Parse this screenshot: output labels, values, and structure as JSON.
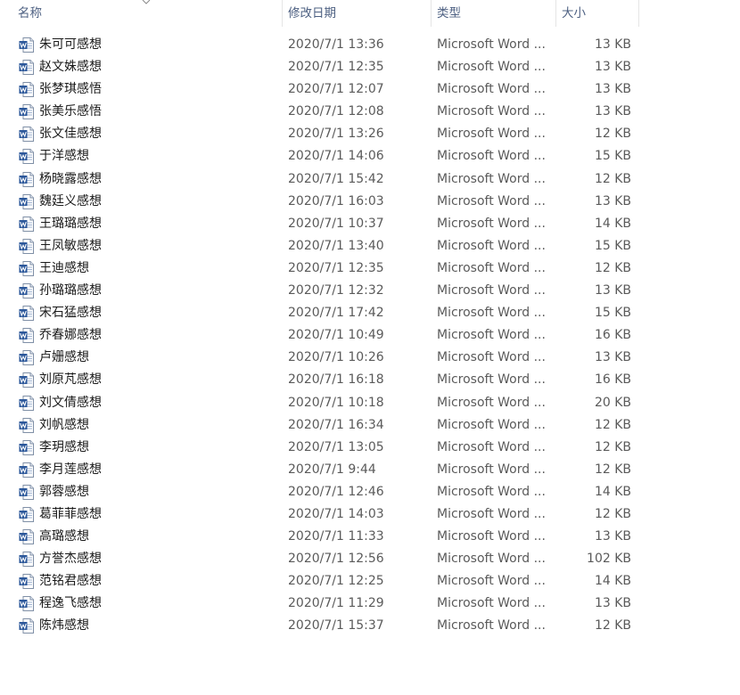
{
  "columns": {
    "name": "名称",
    "date": "修改日期",
    "type": "类型",
    "size": "大小"
  },
  "icons": {
    "file": "word-document-icon",
    "sort": "chevron-down-icon"
  },
  "colors": {
    "header_text": "#4d6082",
    "word_blue": "#2b579a"
  },
  "files": [
    {
      "name": "朱可可感想",
      "date": "2020/7/1 13:36",
      "type": "Microsoft Word ...",
      "size": "13 KB"
    },
    {
      "name": "赵文姝感想",
      "date": "2020/7/1 12:35",
      "type": "Microsoft Word ...",
      "size": "13 KB"
    },
    {
      "name": "张梦琪感悟",
      "date": "2020/7/1 12:07",
      "type": "Microsoft Word ...",
      "size": "13 KB"
    },
    {
      "name": "张美乐感悟",
      "date": "2020/7/1 12:08",
      "type": "Microsoft Word ...",
      "size": "13 KB"
    },
    {
      "name": "张文佳感想",
      "date": "2020/7/1 13:26",
      "type": "Microsoft Word ...",
      "size": "12 KB"
    },
    {
      "name": "于洋感想",
      "date": "2020/7/1 14:06",
      "type": "Microsoft Word ...",
      "size": "15 KB"
    },
    {
      "name": "杨晓露感想",
      "date": "2020/7/1 15:42",
      "type": "Microsoft Word ...",
      "size": "12 KB"
    },
    {
      "name": "魏廷义感想",
      "date": "2020/7/1 16:03",
      "type": "Microsoft Word ...",
      "size": "13 KB"
    },
    {
      "name": "王璐璐感想",
      "date": "2020/7/1 10:37",
      "type": "Microsoft Word ...",
      "size": "14 KB"
    },
    {
      "name": "王凤敏感想",
      "date": "2020/7/1 13:40",
      "type": "Microsoft Word ...",
      "size": "15 KB"
    },
    {
      "name": "王迪感想",
      "date": "2020/7/1 12:35",
      "type": "Microsoft Word ...",
      "size": "12 KB"
    },
    {
      "name": "孙璐璐感想",
      "date": "2020/7/1 12:32",
      "type": "Microsoft Word ...",
      "size": "13 KB"
    },
    {
      "name": "宋石猛感想",
      "date": "2020/7/1 17:42",
      "type": "Microsoft Word ...",
      "size": "15 KB"
    },
    {
      "name": "乔春娜感想",
      "date": "2020/7/1 10:49",
      "type": "Microsoft Word ...",
      "size": "16 KB"
    },
    {
      "name": "卢姗感想",
      "date": "2020/7/1 10:26",
      "type": "Microsoft Word ...",
      "size": "13 KB"
    },
    {
      "name": "刘原芃感想",
      "date": "2020/7/1 16:18",
      "type": "Microsoft Word ...",
      "size": "16 KB"
    },
    {
      "name": "刘文倩感想",
      "date": "2020/7/1 10:18",
      "type": "Microsoft Word ...",
      "size": "20 KB"
    },
    {
      "name": "刘帆感想",
      "date": "2020/7/1 16:34",
      "type": "Microsoft Word ...",
      "size": "12 KB"
    },
    {
      "name": "李玥感想",
      "date": "2020/7/1 13:05",
      "type": "Microsoft Word ...",
      "size": "12 KB"
    },
    {
      "name": "李月莲感想",
      "date": "2020/7/1 9:44",
      "type": "Microsoft Word ...",
      "size": "12 KB"
    },
    {
      "name": "郭蓉感想",
      "date": "2020/7/1 12:46",
      "type": "Microsoft Word ...",
      "size": "14 KB"
    },
    {
      "name": "葛菲菲感想",
      "date": "2020/7/1 14:03",
      "type": "Microsoft Word ...",
      "size": "12 KB"
    },
    {
      "name": "高璐感想",
      "date": "2020/7/1 11:33",
      "type": "Microsoft Word ...",
      "size": "13 KB"
    },
    {
      "name": "方誉杰感想",
      "date": "2020/7/1 12:56",
      "type": "Microsoft Word ...",
      "size": "102 KB"
    },
    {
      "name": "范铭君感想",
      "date": "2020/7/1 12:25",
      "type": "Microsoft Word ...",
      "size": "14 KB"
    },
    {
      "name": "程逸飞感想",
      "date": "2020/7/1 11:29",
      "type": "Microsoft Word ...",
      "size": "13 KB"
    },
    {
      "name": "陈炜感想",
      "date": "2020/7/1 15:37",
      "type": "Microsoft Word ...",
      "size": "12 KB"
    }
  ]
}
